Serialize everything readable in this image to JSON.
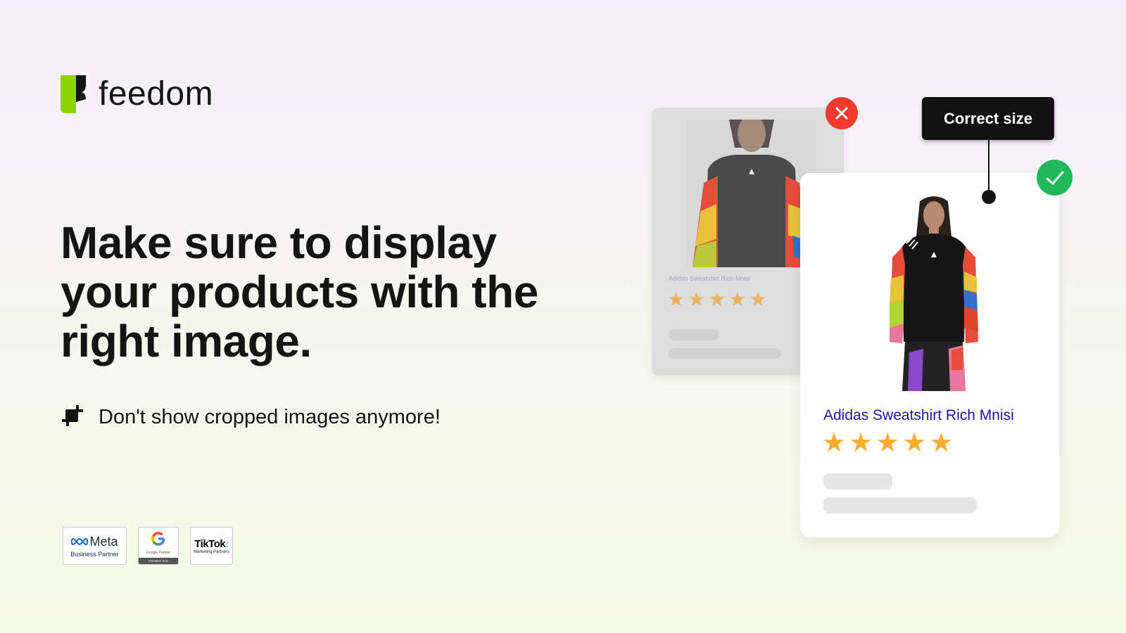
{
  "brand": {
    "name": "feedom",
    "accent": "#8fd400"
  },
  "hero": {
    "headline": "Make sure to display your products with the right image.",
    "feature": {
      "icon": "crop-icon",
      "text": "Don't show cropped images anymore!"
    }
  },
  "partners": [
    {
      "name": "Meta",
      "subtitle": "Business Partner"
    },
    {
      "name": "Google",
      "subtitle": "Google Partner",
      "footer": "PREMIER 2022"
    },
    {
      "name": "TikTok",
      "subtitle": "Marketing Partners"
    }
  ],
  "comparison": {
    "bad": {
      "status_icon": "close-icon",
      "status_color": "#f33a2e",
      "product_title": "Adidas Sweatshirt Rich Mnisi",
      "rating": 5,
      "rating_max": 5
    },
    "good": {
      "status_icon": "check-icon",
      "status_color": "#1fb85b",
      "tooltip": "Correct size",
      "product_title": "Adidas Sweatshirt Rich Mnisi",
      "rating": 5,
      "rating_max": 5
    }
  },
  "stars": {
    "glyph": "★"
  }
}
